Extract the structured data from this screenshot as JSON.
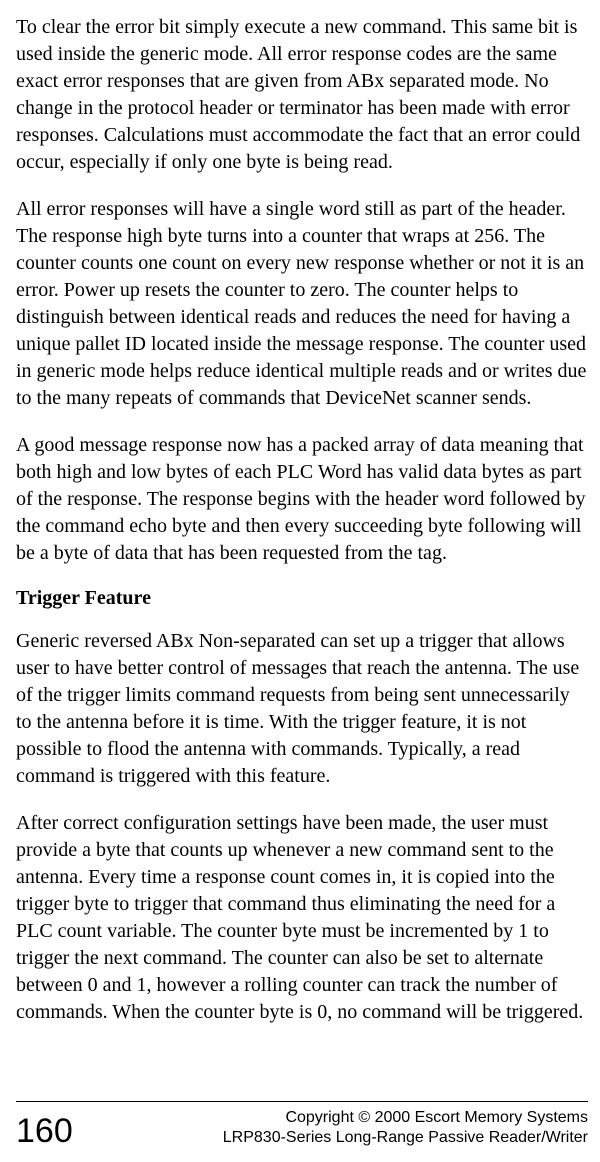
{
  "paragraphs": {
    "p1": "To clear the error bit simply execute a new command. This same bit is used inside the generic mode. All error response codes are the same exact error responses that are given from ABx separated mode. No change in the proto­col header or terminator has been made with error responses. Calculations must accommodate the fact that an error could occur, especially if only one byte is being read.",
    "p2": "All error responses will have a single word still as part of the header. The re­sponse high byte turns into a counter that wraps at 256. The counter counts one count on every new response whether or not it is an error. Power up re­sets the counter to zero. The counter helps to distinguish between identical reads and reduces the need for having a unique pallet ID located inside the message response. The counter used in generic mode helps reduce identical multiple reads and or writes due to the many repeats of commands that DeviceNet scanner sends.",
    "p3": "A good message response now has a packed array of data meaning that both high and low bytes of each PLC Word has valid data bytes as part of the response. The response begins with the header word followed by the com­mand echo byte and then every succeeding byte following will be a byte of data that has been requested from the tag.",
    "p4": "Generic reversed ABx Non-separated can set up a trigger that allows user to have better control of messages that reach the antenna. The use of the trigger limits command requests from being sent unnecessarily to the antenna be­fore it is time. With the trigger feature, it is not possible to flood the antenna with commands. Typically, a read command is triggered with this feature.",
    "p5": "After correct configuration settings have been made, the user must provide a byte that counts up whenever a new command sent to the antenna. Every time a response count comes in, it is copied into the trigger byte to trigger that command thus eliminating the need for a PLC count variable. The coun­ter byte must be incremented by 1 to trigger the next command. The counter can also be set to alternate between 0 and 1, however a rolling counter can track the number of commands. When the counter byte is 0, no command will be triggered."
  },
  "heading": "Trigger Feature",
  "footer": {
    "page_number": "160",
    "copyright": "Copyright © 2000 Escort Memory Systems",
    "product": "LRP830-Series Long-Range Passive Reader/Writer"
  }
}
